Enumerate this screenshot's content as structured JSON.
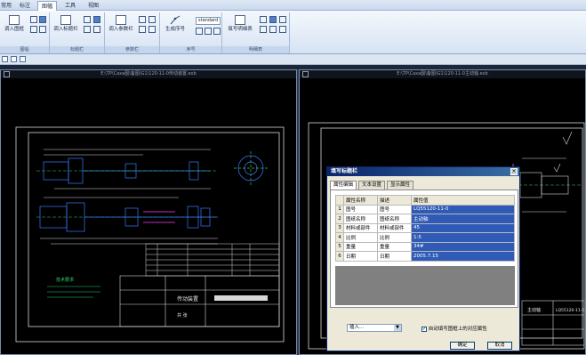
{
  "tabs": [
    "常用",
    "标注",
    "图幅",
    "工具",
    "视图"
  ],
  "active_tab_index": 2,
  "ribbon": {
    "groups": [
      "图幅",
      "标题栏",
      "参数栏",
      "序号",
      "明细表"
    ],
    "buttons": {
      "insert_frame": "调入图框",
      "insert_title": "调入标题栏",
      "insert_param": "调入参数栏",
      "gen_seq": "生成序号",
      "fill_bom": "填写明细表"
    },
    "seq_style_combo": "standard"
  },
  "windows": {
    "left_title": "E:\\TP\\Caxa图\\备图\\G1\\120-11-0传动装置.exb",
    "right_title": "E:\\TP\\Caxa图\\备图\\G1\\120-11-0主动轴.exb"
  },
  "drawing": {
    "left_titleblock_name": "传动装置",
    "left_titleblock_sub": "共 张",
    "right_titleblock_name": "主动轴",
    "right_code": "LQ55120-11-0",
    "left_note": "技术要求"
  },
  "dialog": {
    "title": "填写标题栏",
    "close": "×",
    "tabs": [
      "属性编辑",
      "文本设置",
      "显示属性"
    ],
    "active_tab": 0,
    "columns": [
      "属性名称",
      "描述",
      "属性值"
    ],
    "rows": [
      {
        "n": "1",
        "name": "图号",
        "desc": "图号",
        "value": "LQ55120-11-0"
      },
      {
        "n": "2",
        "name": "图纸名称",
        "desc": "图纸名称",
        "value": "主动轴"
      },
      {
        "n": "3",
        "name": "材料或部件",
        "desc": "材料或部件",
        "value": "45"
      },
      {
        "n": "4",
        "name": "比例",
        "desc": "比例",
        "value": "1:5"
      },
      {
        "n": "5",
        "name": "重量",
        "desc": "重量",
        "value": "34#"
      },
      {
        "n": "6",
        "name": "日期",
        "desc": "日期",
        "value": "2005.7.15"
      }
    ],
    "insert_select": "插入...",
    "checkbox_label": "自动填写图框上的对应属性",
    "checkbox_checked": true,
    "ok": "确定",
    "cancel": "取消"
  }
}
